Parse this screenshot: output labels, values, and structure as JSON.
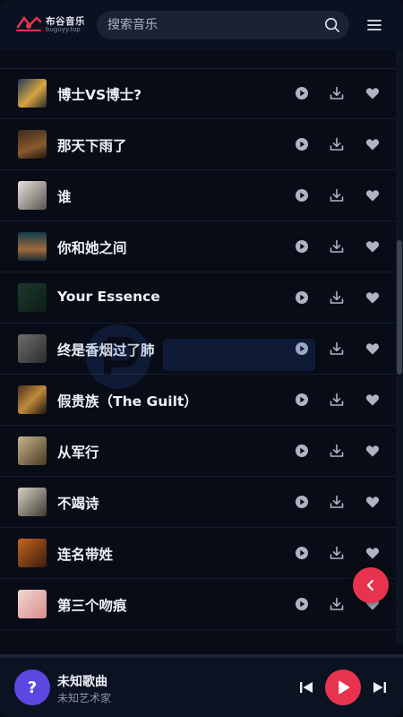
{
  "header": {
    "logo_title": "布谷音乐",
    "logo_sub": "buguyy.top",
    "search_placeholder": "搜索音乐"
  },
  "songs": [
    {
      "title": "博士VS博士?"
    },
    {
      "title": "那天下雨了"
    },
    {
      "title": "谁"
    },
    {
      "title": "你和她之间"
    },
    {
      "title": "Your Essence"
    },
    {
      "title": "终是香烟过了肺"
    },
    {
      "title": "假贵族（The Guilt）"
    },
    {
      "title": "从军行"
    },
    {
      "title": "不竭诗"
    },
    {
      "title": "连名带姓"
    },
    {
      "title": "第三个吻痕"
    }
  ],
  "player": {
    "avatar_text": "?",
    "title": "未知歌曲",
    "artist": "未知艺术家"
  },
  "colors": {
    "accent": "#e8334f",
    "avatar": "#5b48e0",
    "background": "#070c17"
  }
}
